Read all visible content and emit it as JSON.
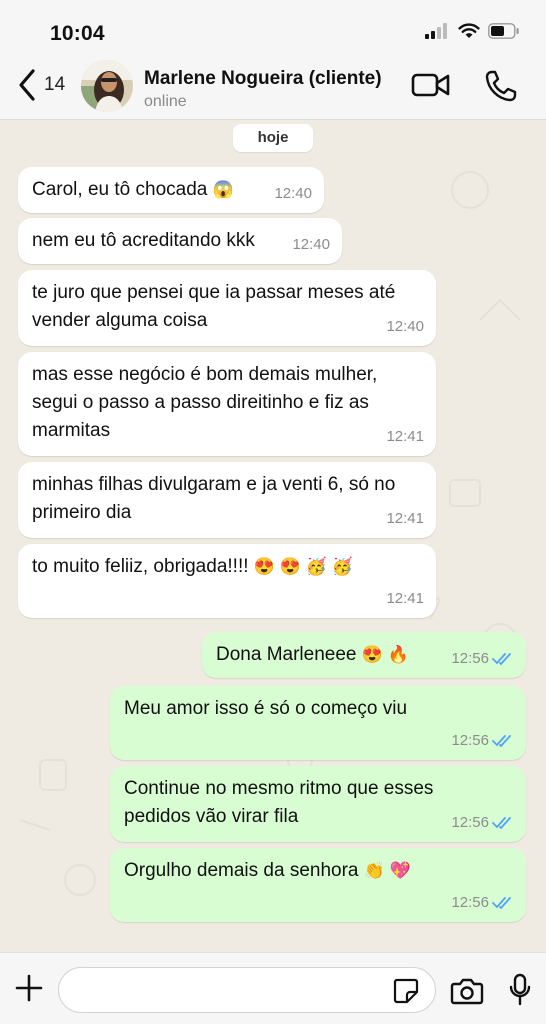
{
  "status_bar": {
    "time": "10:04"
  },
  "header": {
    "back_count": "14",
    "contact_name": "Marlene Nogueira (cliente)",
    "contact_status": "online"
  },
  "chat": {
    "day_label": "hoje",
    "messages": [
      {
        "direction": "in",
        "text": "Carol, eu tô chocada",
        "emoji": "😱",
        "time": "12:40"
      },
      {
        "direction": "in",
        "text": "nem eu tô acreditando kkk",
        "time": "12:40"
      },
      {
        "direction": "in",
        "text": "te juro que pensei que ia passar meses até vender alguma coisa",
        "time": "12:40"
      },
      {
        "direction": "in",
        "text": "mas esse negócio é bom demais mulher, segui o passo a passo direitinho e fiz as marmitas",
        "time": "12:41"
      },
      {
        "direction": "in",
        "text": "minhas filhas divulgaram e ja venti 6, só no primeiro dia",
        "time": "12:41"
      },
      {
        "direction": "in",
        "text": "to muito feliiz, obrigada!!!!",
        "emoji": "😍 😍 🥳 🥳",
        "time": "12:41"
      },
      {
        "direction": "out",
        "text": "Dona Marleneee",
        "emoji": "😍 🔥",
        "time": "12:56",
        "status": "read"
      },
      {
        "direction": "out",
        "text": "Meu amor isso é só o começo viu",
        "time": "12:56",
        "status": "read"
      },
      {
        "direction": "out",
        "text": "Continue no mesmo ritmo que esses pedidos vão virar fila",
        "time": "12:56",
        "status": "read"
      },
      {
        "direction": "out",
        "text": "Orgulho demais da senhora",
        "emoji": "👏 💖",
        "time": "12:56",
        "status": "read"
      }
    ]
  },
  "composer": {
    "placeholder": ""
  },
  "colors": {
    "incoming_bubble": "#ffffff",
    "outgoing_bubble": "#d9fdd3",
    "chat_background": "#efeae2",
    "read_ticks": "#4fa3f7"
  },
  "icons": [
    "back-chevron-icon",
    "video-call-icon",
    "phone-icon",
    "plus-icon",
    "sticker-icon",
    "camera-icon",
    "microphone-icon",
    "double-check-icon"
  ]
}
